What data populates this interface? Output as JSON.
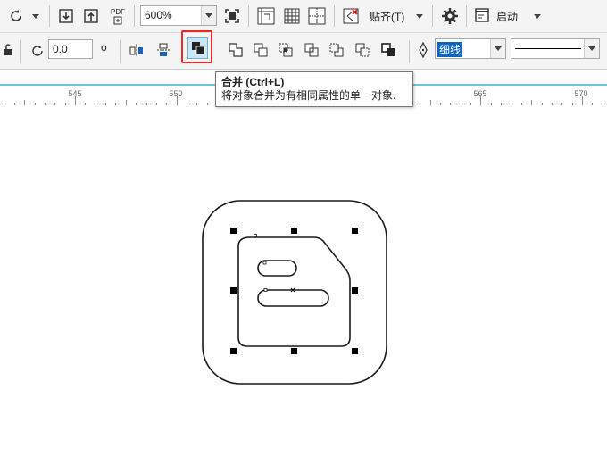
{
  "toolbar_top": {
    "rotate_icon": "rotate-icon",
    "zoom_value": "600%",
    "snap_label": "贴齐(T)",
    "launch_label": "启动",
    "pdf_label": "PDF"
  },
  "toolbar_prop": {
    "rotation_value": "0.0",
    "outline_width": "细线"
  },
  "ruler": {
    "labels": [
      "545",
      "550",
      "565",
      "570"
    ]
  },
  "tooltip": {
    "title": "合并 (Ctrl+L)",
    "description": "将对象合并为有相同属性的单一对象."
  },
  "colors": {
    "highlight_frame": "#e8292b",
    "ruler_line": "#6ec3d6",
    "selected_button_bg": "#c9e6f7"
  }
}
